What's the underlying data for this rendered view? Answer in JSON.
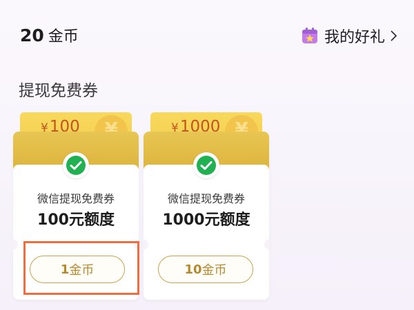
{
  "header": {
    "coin_amount": "20",
    "coin_unit": "金币",
    "gift_label": "我的好礼",
    "gift_icon": "gift-box-icon",
    "chevron_icon": "chevron-right-icon"
  },
  "section": {
    "title": "提现免费券"
  },
  "cards": [
    {
      "amount": "100",
      "currency": "¥",
      "label": "微信提现免费券",
      "quota": "100元额度",
      "price_num": "1",
      "price_unit": "金币",
      "icon": "wechat-pay-icon"
    },
    {
      "amount": "1000",
      "currency": "¥",
      "label": "微信提现免费券",
      "quota": "1000元额度",
      "price_num": "10",
      "price_unit": "金币",
      "icon": "wechat-pay-icon"
    }
  ],
  "colors": {
    "accent_gold": "#c9a24b",
    "coupon_yellow": "#f8d95c",
    "amount_red": "#c4541e",
    "highlight_orange": "#f26d3d"
  }
}
